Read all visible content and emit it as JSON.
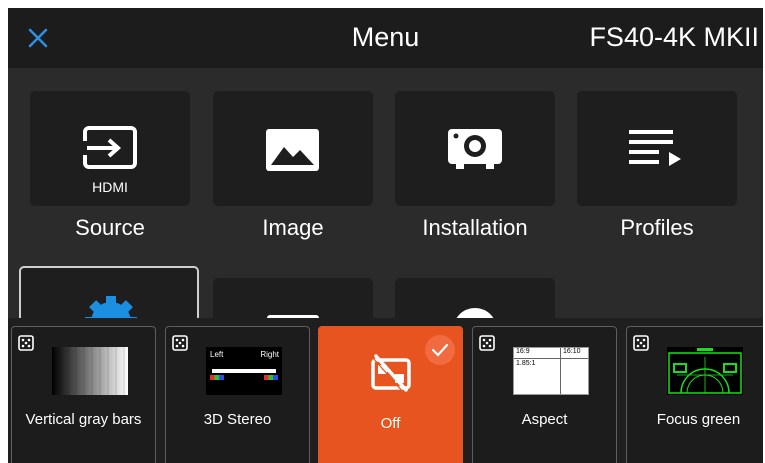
{
  "header": {
    "title": "Menu",
    "device": "FS40-4K MKII"
  },
  "menu_tiles": [
    {
      "label": "Source",
      "sublabel": "HDMI",
      "icon": "input-arrow-icon"
    },
    {
      "label": "Image",
      "icon": "image-icon"
    },
    {
      "label": "Installation",
      "icon": "projector-icon"
    },
    {
      "label": "Profiles",
      "icon": "playlist-icon"
    },
    {
      "label": "",
      "icon": "gear-icon"
    },
    {
      "label": "",
      "icon": "unknown"
    },
    {
      "label": "",
      "icon": "unknown"
    }
  ],
  "test_patterns": [
    {
      "label": "Vertical gray bars",
      "selected": false
    },
    {
      "label": "3D Stereo",
      "selected": false,
      "thumb_left": "Left",
      "thumb_right": "Right"
    },
    {
      "label": "Off",
      "selected": true
    },
    {
      "label": "Aspect",
      "selected": false,
      "thumb_texts": [
        "16:9",
        "16:10",
        "1.85:1"
      ]
    },
    {
      "label": "Focus green",
      "selected": false
    }
  ],
  "colors": {
    "accent": "#e8541f",
    "close_icon": "#2f8fe0",
    "settings_icon": "#1d8fe1"
  }
}
